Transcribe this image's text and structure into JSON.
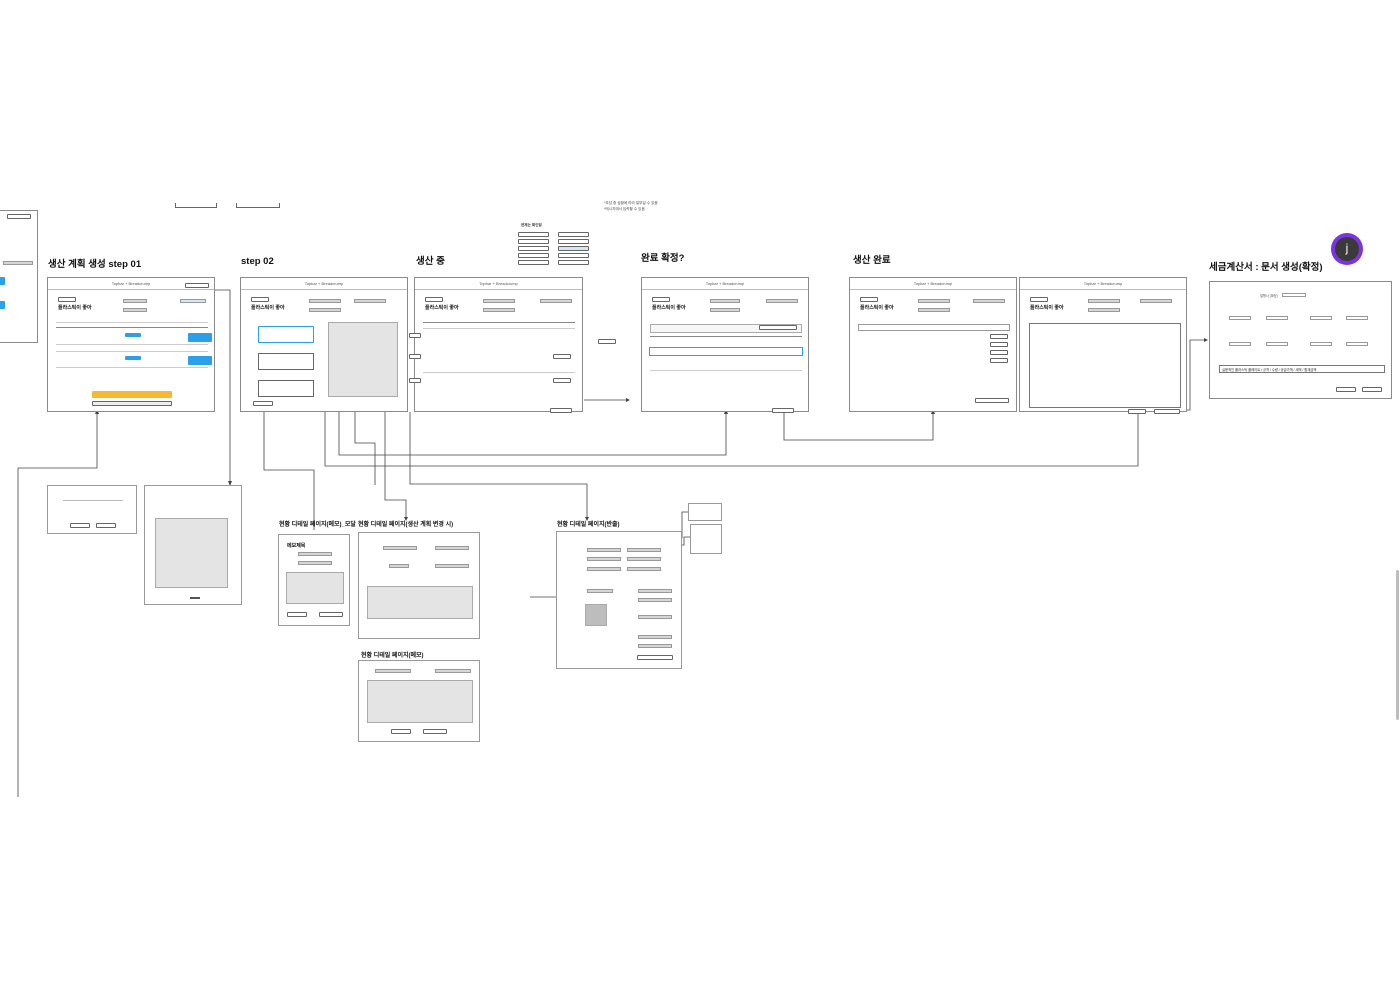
{
  "sections": {
    "step01": "생산 계획 생성 step 01",
    "step02": "step 02",
    "producing": "생산 중",
    "confirm": "완료 확정?",
    "done": "생산 완료",
    "invoice": "세금계산서 : 문서 생성(확정)"
  },
  "frame": {
    "topbar": "Topbar + Breadcrump",
    "company": "플라스틱이 좋아"
  },
  "subpages": {
    "memo_modal": "현황 디테일 페이지(메모)_모달",
    "plan_change": "현황 디테일 페이지(생산 계획 변경 시)",
    "return": "현황 디테일 페이지(반출)",
    "memo": "현황 디테일 페이지(메모)",
    "memo_title": "메모제목"
  },
  "invoice": {
    "field": "발행사 (확정)",
    "item_text": "실용적인 플라스틱 플레이트 / 규격 / 수량 / 공급가액 / 세액 / 합계금액"
  },
  "notes": {
    "top_note_1": "*부담 중 상황에 따라 일부일 수 있음",
    "top_note_2": "*메시지에서 입력할 수 있음",
    "history_title": "변제는 확인일"
  },
  "avatar": {
    "letter": "j",
    "ring_color": "#7b34e0"
  },
  "colors": {
    "accent_blue": "#2aa0ea",
    "accent_yellow": "#f5b82e"
  }
}
